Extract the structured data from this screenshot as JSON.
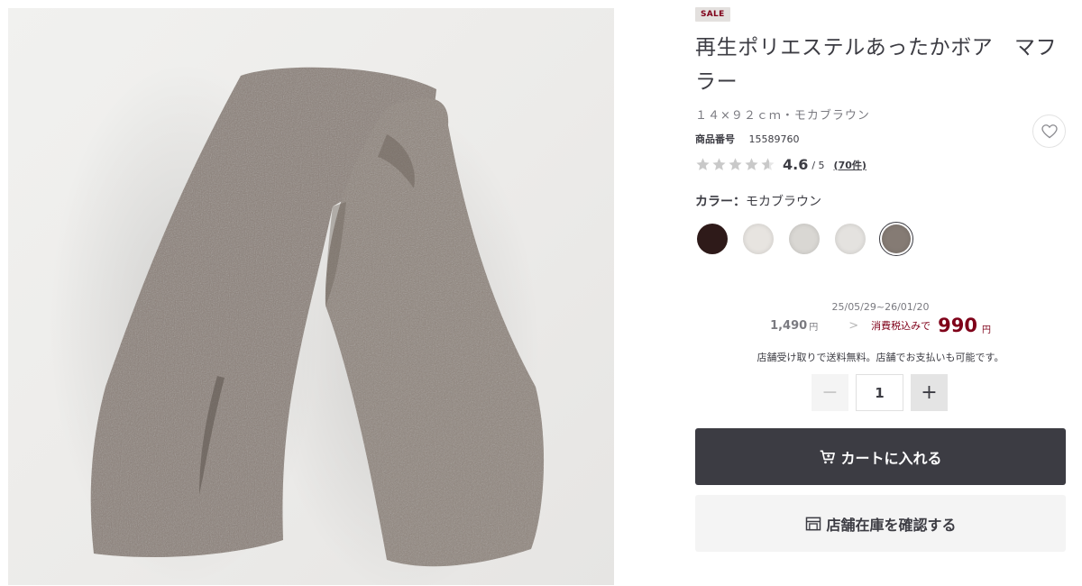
{
  "product": {
    "badge": "SALE",
    "title": "再生ポリエステルあったかボア　マフラー",
    "variant": "１４×９２ｃｍ・モカブラウン",
    "code_label": "商品番号",
    "code": "15589760"
  },
  "rating": {
    "score": "4.6",
    "max": "/ 5",
    "reviews": "(70件)",
    "stars_value": 4.6
  },
  "color": {
    "label": "カラー：",
    "selected": "モカブラウン",
    "swatches": [
      "#2e1a19",
      "#e7e4e0",
      "#d9d7d3",
      "#e4e2df",
      "#857b74"
    ]
  },
  "price": {
    "period": "25/05/29~26/01/20",
    "old": "1,490",
    "old_unit": "円",
    "chevron": ">",
    "tax_label": "消費税込みで",
    "new": "990",
    "new_unit": "円"
  },
  "delivery_note": "店舗受け取りで送料無料。店舗でお支払いも可能です。",
  "quantity": {
    "minus": "−",
    "value": "1",
    "plus": "+"
  },
  "buttons": {
    "cart": "カートに入れる",
    "stock": "店舗在庫を確認する"
  },
  "icons": {
    "favorite": "heart-icon",
    "cart": "cart-icon",
    "stock": "store-icon",
    "chevron": "chevron-right-icon"
  },
  "colors": {
    "accent": "#7f0019",
    "primary_button": "#3c3c43",
    "secondary_button": "#f4f4f4"
  }
}
